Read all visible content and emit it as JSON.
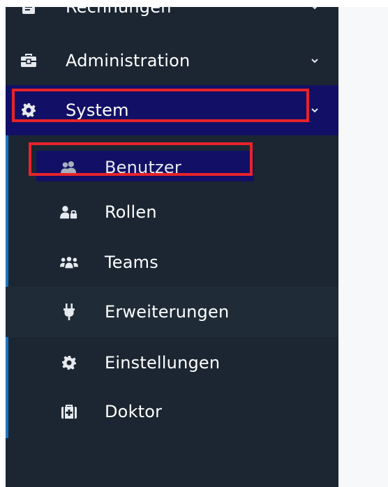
{
  "sidebar": {
    "items": [
      {
        "label": "Rechnungen",
        "icon": "invoice-icon"
      },
      {
        "label": "Administration",
        "icon": "toolbox-icon"
      },
      {
        "label": "System",
        "icon": "gear-icon",
        "active": true
      }
    ],
    "subitems": [
      {
        "label": "Benutzer",
        "icon": "users-icon",
        "active": true
      },
      {
        "label": "Rollen",
        "icon": "user-lock-icon"
      },
      {
        "label": "Teams",
        "icon": "group-icon"
      },
      {
        "label": "Erweiterungen",
        "icon": "plug-icon"
      },
      {
        "label": "Einstellungen",
        "icon": "gear-icon"
      },
      {
        "label": "Doktor",
        "icon": "medical-kit-icon"
      }
    ]
  },
  "colors": {
    "sidebar_bg": "#1b2632",
    "active_bg": "#121066",
    "highlight_border": "#e8232a",
    "active_line": "#1e73be",
    "content_bg": "#f6f8fa"
  }
}
